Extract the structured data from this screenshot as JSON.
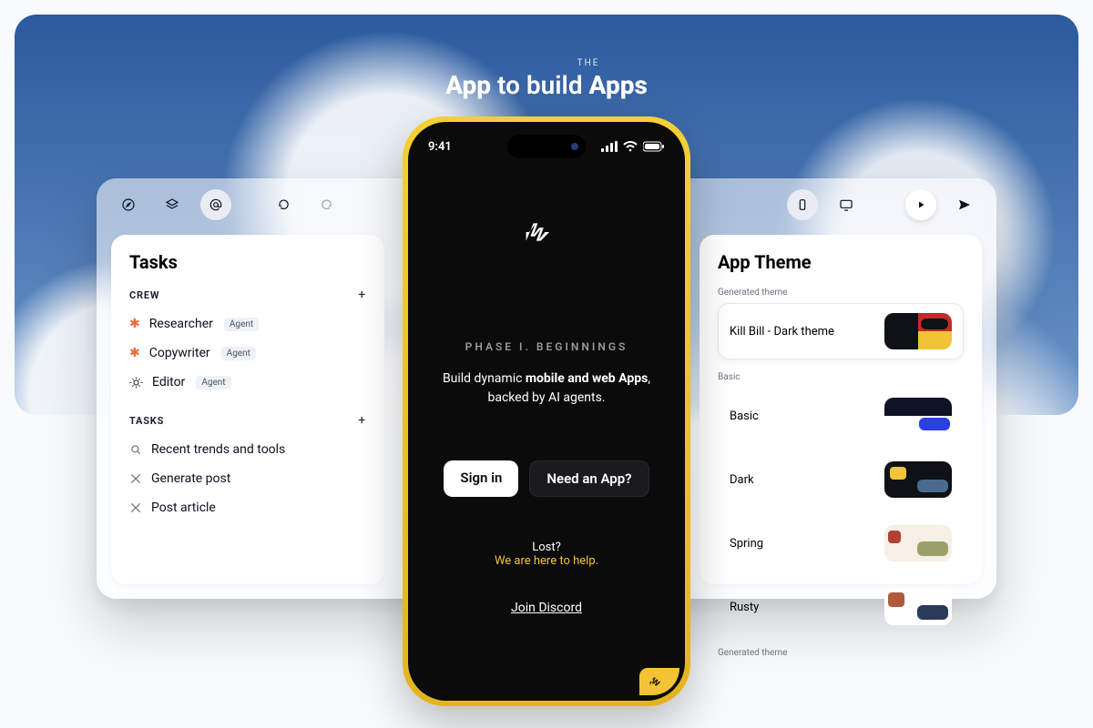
{
  "hero": {
    "eyebrow": "THE",
    "line_prefix_bold": "App",
    "line_mid": " to build ",
    "line_suffix_bold": "Apps"
  },
  "toolbar": {
    "icons": {
      "compass": "compass-icon",
      "layers": "layers-icon",
      "mention": "mention-icon",
      "undo": "undo-icon",
      "redo": "redo-icon",
      "device_mobile": "mobile-icon",
      "device_desktop": "desktop-icon",
      "play": "play-icon",
      "send": "send-icon"
    }
  },
  "tasks_panel": {
    "title": "Tasks",
    "crew_label": "CREW",
    "tasks_label": "TASKS",
    "crew": [
      {
        "name": "Researcher",
        "badge": "Agent",
        "icon": "asterisk"
      },
      {
        "name": "Copywriter",
        "badge": "Agent",
        "icon": "asterisk"
      },
      {
        "name": "Editor",
        "badge": "Agent",
        "icon": "openai"
      }
    ],
    "tasks": [
      {
        "name": "Recent trends and tools",
        "icon": "search"
      },
      {
        "name": "Generate post",
        "icon": "x"
      },
      {
        "name": "Post article",
        "icon": "x"
      }
    ]
  },
  "theme_panel": {
    "title": "App Theme",
    "generated_label": "Generated theme",
    "basic_label": "Basic",
    "generated_label_2": "Generated theme",
    "selected": {
      "name": "Kill Bill - Dark theme",
      "swatch": "sw-killbill"
    },
    "themes": [
      {
        "name": "Basic",
        "swatch": "sw-basic"
      },
      {
        "name": "Dark",
        "swatch": "sw-dark"
      },
      {
        "name": "Spring",
        "swatch": "sw-spring"
      },
      {
        "name": "Rusty",
        "swatch": "sw-rusty"
      }
    ]
  },
  "phone": {
    "time": "9:41",
    "phase": "PHASE I. BEGINNINGS",
    "tag_prefix": "Build dynamic ",
    "tag_bold": "mobile and web Apps",
    "tag_suffix": ", backed by AI agents.",
    "signin_label": "Sign in",
    "need_label": "Need an App?",
    "lost": "Lost?",
    "help": "We are here to help.",
    "discord": "Join Discord"
  }
}
